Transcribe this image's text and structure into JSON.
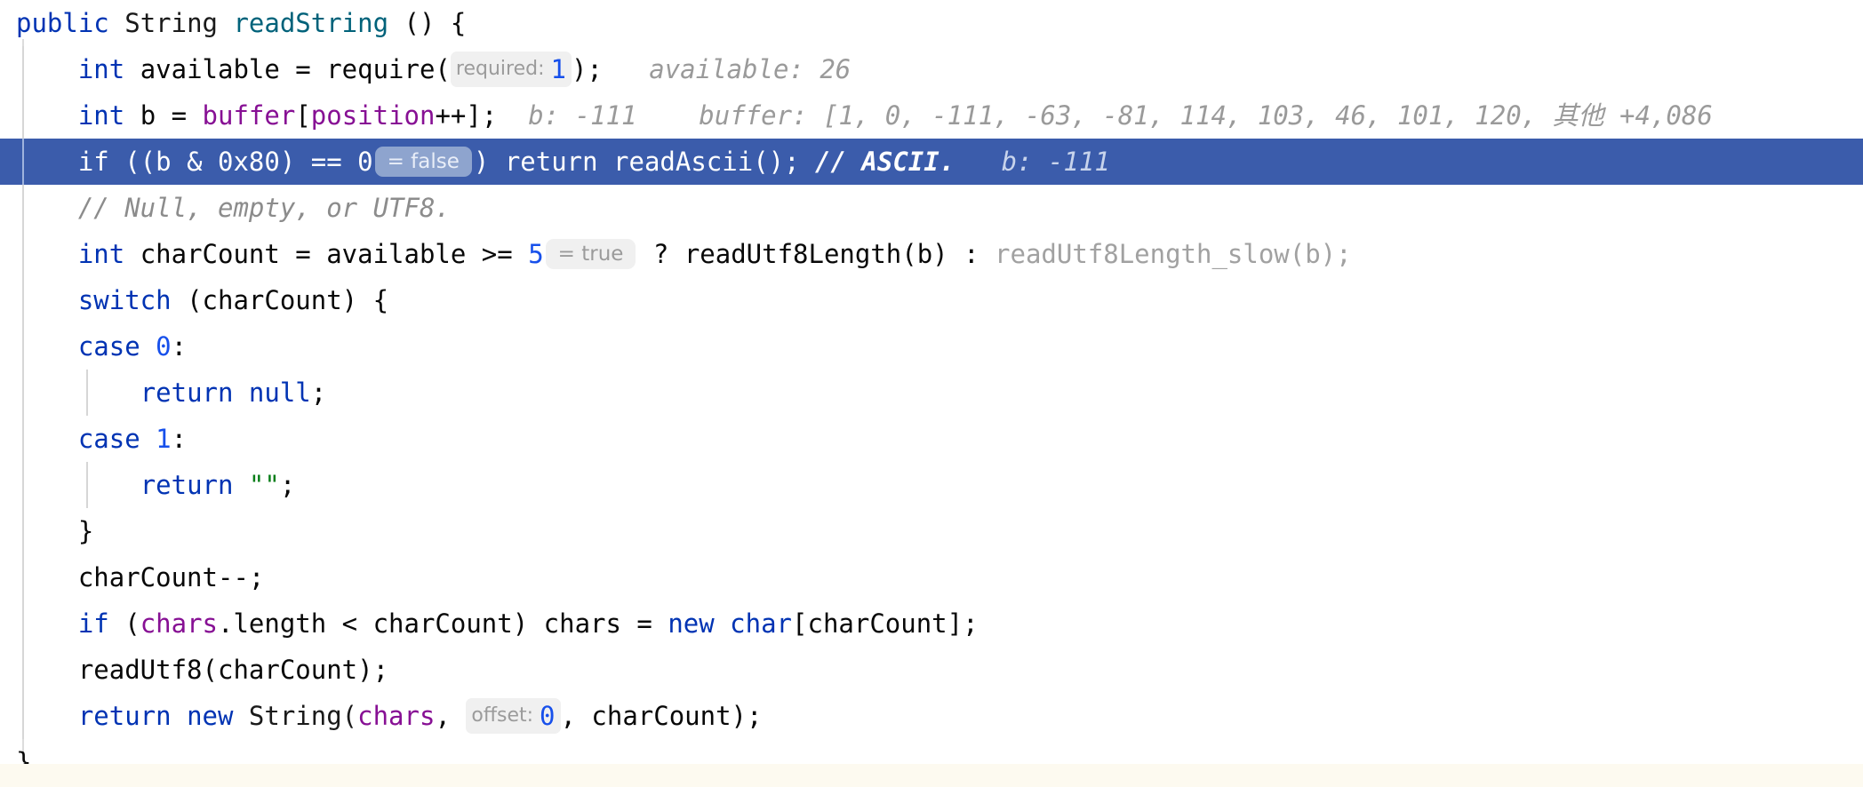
{
  "editor": {
    "language": "java",
    "theme": "light",
    "mode": "debug-paused",
    "colors": {
      "background": "#ffffff",
      "foreground": "#080808",
      "selected_line_background": "#3b5cab",
      "selected_line_foreground": "#ffffff",
      "keyword": "#0033b3",
      "field": "#871094",
      "method_declaration": "#00627a",
      "number": "#1750eb",
      "string": "#067d17",
      "comment": "#8c8c8c",
      "inline_debug_value": "#9a9a9a",
      "dimmed_code": "#a1a1a1",
      "hint_pill_background": "#f0f0f0",
      "hint_pill_foreground": "#9b9b9b",
      "selected_pill_background": "#8ea4ce",
      "indent_guide": "#d6d6d6",
      "bottom_strip": "#fdfaf0"
    }
  },
  "code": {
    "l1": {
      "kw_public": "public",
      "type_string": "String",
      "method": "readString",
      "parens": " () {"
    },
    "l2": {
      "kw_int": "int",
      "name": " available = require(",
      "hint_required": "required:",
      "value_1": "1",
      "tail": ");",
      "debug": "available: 26"
    },
    "l3": {
      "kw_int": "int",
      "b": " b = ",
      "fld_buffer": "buffer",
      "bracket_open": "[",
      "fld_position": "position",
      "tail": "++];",
      "debug_b": "b: -111",
      "debug_buffer": "buffer: [1, 0, -111, -63, -81, 114, 103, 46, 101, 120, 其他 +4,086"
    },
    "l4": {
      "kw_if": "if",
      "cond": " ((b & 0x80) == ",
      "zero": "0",
      "pill": "= false",
      "close": ")",
      "kw_return": " return",
      "call": " readAscii();",
      "comment": " // ASCII.",
      "debug": "b: -111"
    },
    "l5": {
      "comment": "// Null, empty, or UTF8."
    },
    "l6": {
      "kw_int": "int",
      "mid": " charCount = available >= ",
      "five": "5",
      "pill": "= true",
      "ternary": " ? readUtf8Length(b) : ",
      "dimmed": "readUtf8Length_slow(b);"
    },
    "l7": {
      "kw_switch": "switch",
      "tail": " (charCount) {"
    },
    "l8": {
      "kw_case": "case",
      "num": "0",
      "colon": ":"
    },
    "l9": {
      "kw_return": "return",
      "kw_null": " null",
      "semi": ";"
    },
    "l10": {
      "kw_case": "case",
      "num": "1",
      "colon": ":"
    },
    "l11": {
      "kw_return": "return",
      "str": " \"\"",
      "semi": ";"
    },
    "l12": {
      "brace": "}"
    },
    "l13": {
      "text": "charCount--;"
    },
    "l14": {
      "kw_if": "if",
      "open": " (",
      "fld_chars": "chars",
      "mid": ".length < charCount) chars = ",
      "kw_new": "new",
      "kw_char": " char",
      "tail": "[charCount];"
    },
    "l15": {
      "text": "readUtf8(charCount);"
    },
    "l16": {
      "kw_return": "return",
      "kw_new": " new",
      "type_string": " String(",
      "fld_chars": "chars",
      "comma": ", ",
      "hint_offset": "offset:",
      "value_0": "0",
      "tail": ", charCount);"
    },
    "l17": {
      "brace": "}"
    }
  }
}
